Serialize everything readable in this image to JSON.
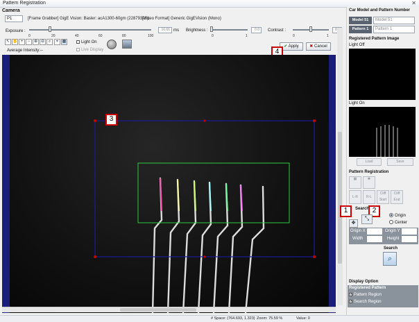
{
  "window": {
    "title": "Pattern Registration",
    "close": "✕"
  },
  "camera": {
    "header": "Camera",
    "selector": "P1",
    "frame_grabber": "[Frame Grabber] GigE Vision: Basler: acA1300-60gm (22879398),",
    "video_format": "[Video Format] Generic GigEVision (Mono)"
  },
  "exposure": {
    "label": "Exposure :",
    "ticks": [
      "0",
      "20",
      "40",
      "60",
      "80",
      "100"
    ],
    "value": "16.66",
    "unit": "ms",
    "level": 0.17
  },
  "brightness": {
    "label": "Brightness :",
    "ticks": [
      "0",
      "1"
    ],
    "value": "0.0",
    "level": 0.0
  },
  "contrast": {
    "label": "Contrast :",
    "ticks": [
      "0",
      "1"
    ],
    "value": "0.5",
    "level": 0.5
  },
  "toolbar": {
    "light_on": "Light On",
    "live_display": "Live Display"
  },
  "avg_intensity": {
    "label": "Average Intensity:",
    "value": "--"
  },
  "actions": {
    "apply": "Apply",
    "cancel": "Cancel"
  },
  "callouts": {
    "c1": "1",
    "c2": "2",
    "c3": "3",
    "c4": "4"
  },
  "right": {
    "header": "Car Model and Pattern Number",
    "model_label": "Model 51",
    "model_value": "Model 51",
    "pattern_label": "Pattern 1",
    "pattern_value": "Pattern 1",
    "registered_header": "Registered Pattern Image",
    "light_off": "Light Off",
    "light_on": "Light On",
    "load": "Load",
    "save": "Save",
    "pattern_registration": "Pattern Registration",
    "lr": "L-R",
    "rl": "R-L",
    "cliff_start": "Cliff Start",
    "cliff_end": "Cliff End",
    "search_re": "Search Re",
    "origin": "Origin",
    "center": "Center",
    "origin_x": "Origin X",
    "origin_y": "Origin Y",
    "width": "Width",
    "height": "Height",
    "search": "Search",
    "display_option": "Display Option",
    "registered_pattern": "Registered Pattern",
    "pattern_region": "Pattern Region",
    "search_region": "Search Region"
  },
  "status": {
    "space": "# Space: (764.693, 1.323)",
    "zoom": "Zoom: 75.59 %",
    "value": "Value: 0"
  },
  "colors": {
    "accent_red": "#cc0000",
    "search_rect": "#1a1a9a",
    "pattern_rect": "#2ecc40",
    "canvas_frame": "#1a1d7a"
  }
}
